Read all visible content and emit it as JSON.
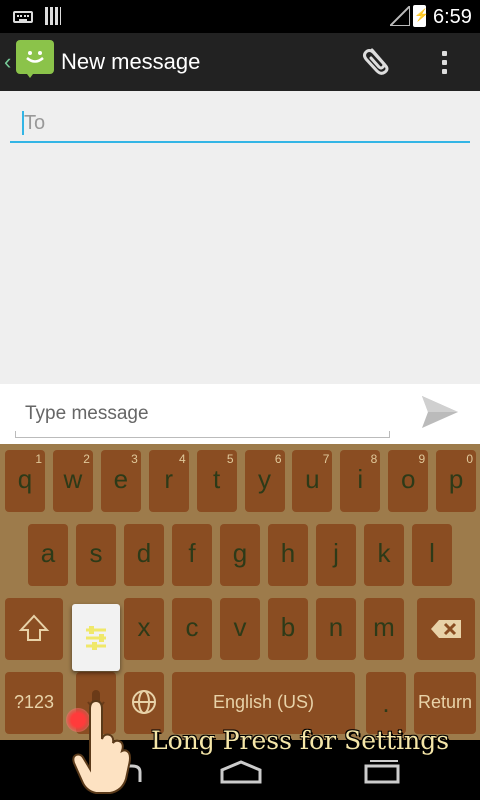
{
  "status_bar": {
    "time": "6:59"
  },
  "action_bar": {
    "title": "New message"
  },
  "compose": {
    "to_placeholder": "To"
  },
  "message": {
    "placeholder": "Type message"
  },
  "keyboard": {
    "row1": [
      {
        "label": "q",
        "num": "1"
      },
      {
        "label": "w",
        "num": "2"
      },
      {
        "label": "e",
        "num": "3"
      },
      {
        "label": "r",
        "num": "4"
      },
      {
        "label": "t",
        "num": "5"
      },
      {
        "label": "y",
        "num": "6"
      },
      {
        "label": "u",
        "num": "7"
      },
      {
        "label": "i",
        "num": "8"
      },
      {
        "label": "o",
        "num": "9"
      },
      {
        "label": "p",
        "num": "0"
      }
    ],
    "row2": [
      "a",
      "s",
      "d",
      "f",
      "g",
      "h",
      "j",
      "k",
      "l"
    ],
    "row3": [
      "x",
      "c",
      "v",
      "b",
      "n",
      "m"
    ],
    "symbols_label": "?123",
    "space_label": "English (US)",
    "period_label": ".",
    "return_label": "Return"
  },
  "hint": "Long Press for Settings",
  "colors": {
    "accent": "#33b5e5",
    "keyboard_bg": "#9d7b4b",
    "key": "#8a4d22"
  }
}
